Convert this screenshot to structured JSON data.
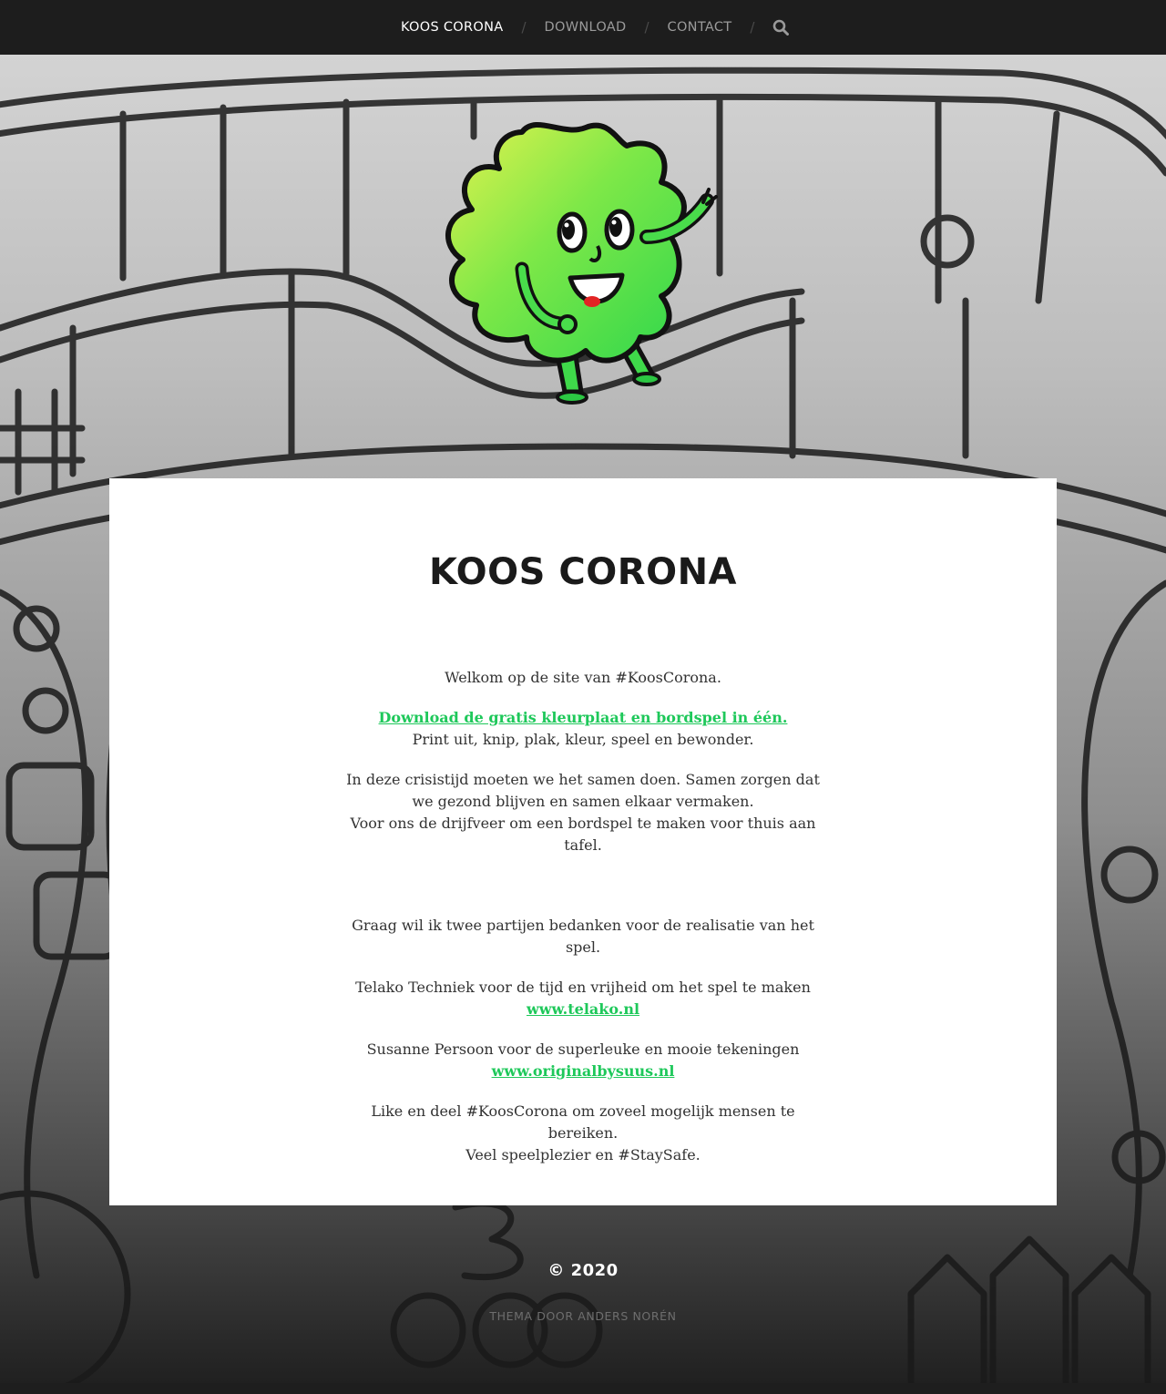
{
  "nav": {
    "items": [
      {
        "label": "KOOS CORONA",
        "current": true
      },
      {
        "label": "DOWNLOAD",
        "current": false
      },
      {
        "label": "CONTACT",
        "current": false
      }
    ],
    "separator": "/",
    "search_icon": "search-icon"
  },
  "header": {
    "logo_icon": "koos-corona-mascot-logo",
    "background_image": "board-game-doodle-illustration"
  },
  "content": {
    "title": "KOOS CORONA",
    "welcome": "Welkom op de site van #KoosCorona.",
    "download_link": "Download de gratis kleurplaat en bordspel in één.",
    "print_text": "Print uit, knip, plak, kleur, speel en bewonder.",
    "crisis_line1": "In deze crisistijd moeten we het samen doen. Samen zorgen dat we gezond blijven en samen elkaar vermaken.",
    "crisis_line2": "Voor ons de drijfveer om een bordspel te maken voor thuis aan tafel.",
    "thanks_intro": "Graag wil ik twee partijen bedanken voor de realisatie van het spel.",
    "telako_text": "Telako Techniek voor de tijd en vrijheid om het spel te maken",
    "telako_link": "www.telako.nl",
    "susanne_text": "Susanne Persoon voor de superleuke en mooie tekeningen",
    "susanne_link": "www.originalbysuus.nl",
    "share_line1": "Like en deel #KoosCorona om zoveel mogelijk mensen te bereiken.",
    "share_line2": "Veel speelplezier en #StaySafe."
  },
  "footer": {
    "copyright": "© 2020",
    "credit_prefix": "THEMA DOOR",
    "credit_author": "ANDERS NORÉN"
  },
  "colors": {
    "nav_bg": "#1d1d1d",
    "link_green": "#1ec85a",
    "mascot_green": "#3ed84a",
    "mascot_yellow": "#d8f04e"
  }
}
